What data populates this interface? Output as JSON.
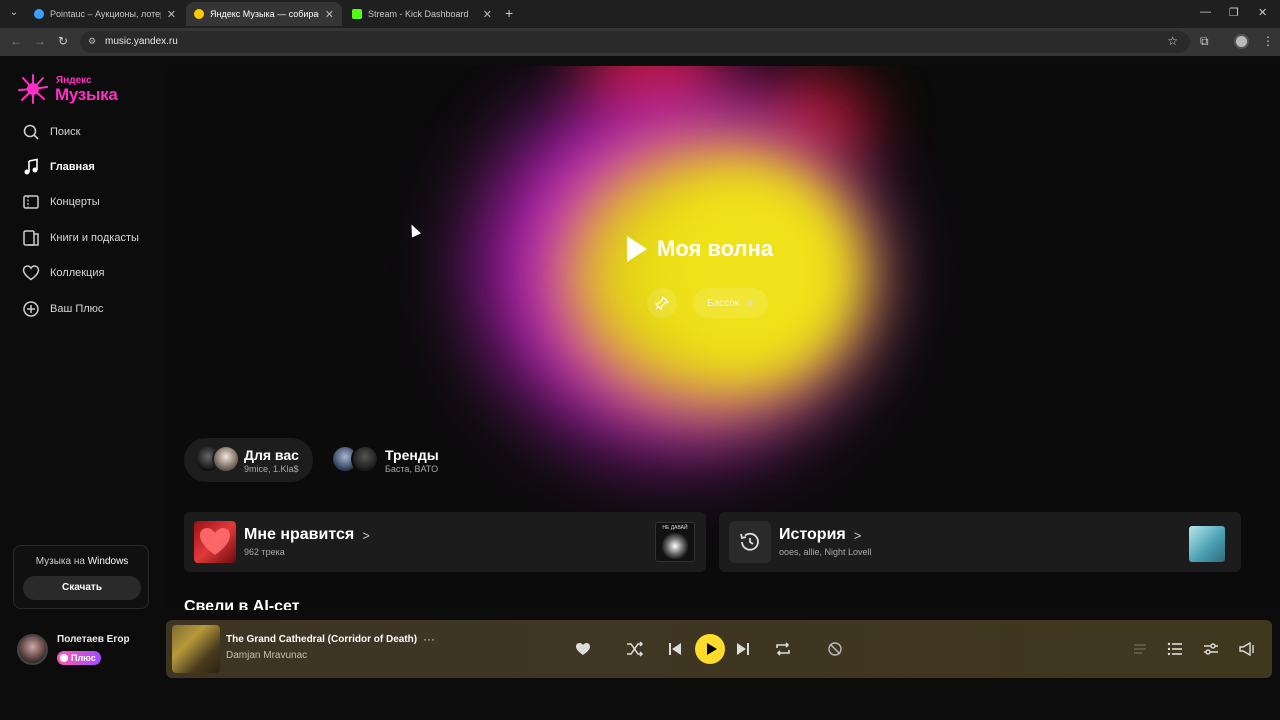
{
  "browser": {
    "tabs": [
      {
        "title": "Pointauc – Аукционы, лотереи",
        "favicon_color": "#3aa0ff",
        "active": false
      },
      {
        "title": "Яндекс Музыка — собираем м",
        "favicon_color": "#ffcc00",
        "active": true
      },
      {
        "title": "Stream - Kick Dashboard",
        "favicon_color": "#53fc18",
        "active": false
      }
    ],
    "new_tab_icon": "plus-icon",
    "url": "music.yandex.ru"
  },
  "sidebar": {
    "logo": {
      "line1": "Яндекс",
      "line2": "Музыка",
      "color": "#ff2ec4"
    },
    "items": [
      {
        "label": "Поиск",
        "icon": "search-icon"
      },
      {
        "label": "Главная",
        "icon": "music-note-icon",
        "active": true
      },
      {
        "label": "Концерты",
        "icon": "ticket-icon"
      },
      {
        "label": "Книги и подкасты",
        "icon": "book-icon"
      },
      {
        "label": "Коллекция",
        "icon": "heart-icon"
      },
      {
        "label": "Ваш Плюс",
        "icon": "plus-circle-icon"
      }
    ],
    "promo": {
      "prefix": "Музыка на ",
      "platform": "Windows",
      "button": "Скачать"
    },
    "user": {
      "name": "Полетаев Егор",
      "badge": "Плюс"
    }
  },
  "main": {
    "wave": {
      "title": "Моя волна",
      "chip": "Бассок"
    },
    "mixes": [
      {
        "title": "Для вас",
        "subtitle": "9mice, 1.Kla$"
      },
      {
        "title": "Тренды",
        "subtitle": "Баста, BATO"
      }
    ],
    "cards": [
      {
        "title": "Мне нравится",
        "subtitle": "962 трека",
        "thumb_label": "НЕ ДАВАЙ"
      },
      {
        "title": "История",
        "subtitle": "ooes, allie, Night Lovell"
      }
    ],
    "section_title": "Свели в AI-сет"
  },
  "player": {
    "track_title": "The Grand Cathedral (Corridor of Death)",
    "artist": "Damjan Mravunac",
    "accent": "#ffdb2b"
  }
}
